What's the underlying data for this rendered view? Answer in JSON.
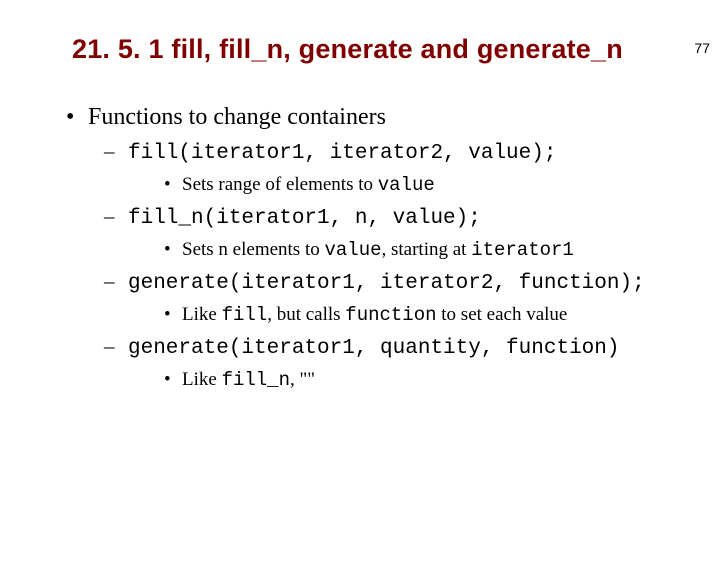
{
  "page_number": "77",
  "title": "21. 5. 1 fill, fill_n, generate and generate_n",
  "bullet1": "Functions to change containers",
  "sig_fill": "fill(iterator1, iterator2, value);",
  "desc_fill_pre": "Sets range of elements to ",
  "desc_fill_code": "value",
  "sig_filln": "fill_n(iterator1, n, value);",
  "desc_filln_pre": "Sets n elements to ",
  "desc_filln_code1": "value",
  "desc_filln_mid": ", starting at ",
  "desc_filln_code2": "iterator1",
  "sig_gen": "generate(iterator1, iterator2, function);",
  "desc_gen_pre": "Like ",
  "desc_gen_code1": "fill",
  "desc_gen_mid": ", but calls ",
  "desc_gen_code2": "function",
  "desc_gen_post": " to set each value",
  "sig_genn": "generate(iterator1, quantity, function)",
  "desc_genn_pre": "Like ",
  "desc_genn_code": "fill_n",
  "desc_genn_post": ", \"\""
}
